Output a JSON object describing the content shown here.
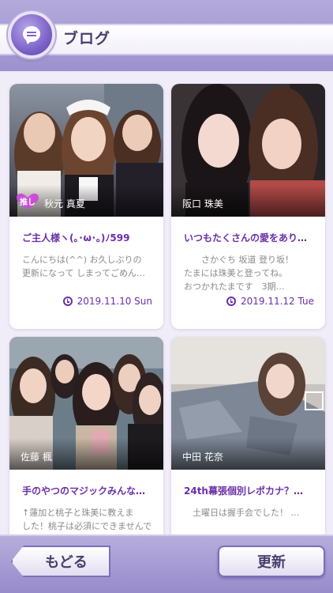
{
  "header": {
    "title": "ブログ"
  },
  "cards": [
    {
      "author": "秋元 真夏",
      "badge": "推し",
      "title": "ご主人様ヽ(｡･ω･｡)ﾉ599",
      "body": "こんにちは(^^) お久しぶりの\n更新になって しまってごめん…",
      "date": "2019.11.10 Sun"
    },
    {
      "author": "阪口 珠美",
      "title": "いつもたくさんの愛をあり…",
      "body": "　　さかぐち 坂道 登り坂！\nたまには珠美と登ってね。\nおつかれたまです　3期…",
      "date": "2019.11.12 Tue"
    },
    {
      "author": "佐藤 楓",
      "title": "手のやつのマジックみんな…",
      "body": "↑蓮加と桃子と珠美に教えま\nした！桃子は必須にできませんで",
      "date": ""
    },
    {
      "author": "中田 花奈",
      "title": "24th幕張個別レポカナ？…",
      "body": "　土曜日は握手会でした！ …",
      "date": ""
    }
  ],
  "footer": {
    "back_label": "もどる",
    "refresh_label": "更新"
  },
  "colors": {
    "accent": "#6b2fa8",
    "header": "#9d92cf",
    "badge": "#c94fd6"
  }
}
